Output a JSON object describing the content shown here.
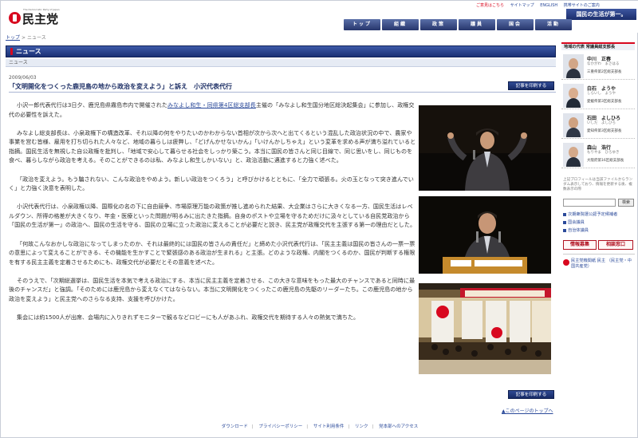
{
  "header": {
    "logo_tag": "The Democratic Party of Japan",
    "logo_name": "民主党",
    "utility": [
      "ご意見はこちら",
      "サイトマップ",
      "ENGLISH",
      "携帯サイトのご案内"
    ],
    "slogan": "国民の生活が第一。",
    "global_nav": [
      "トップ",
      "組織",
      "政策",
      "議員",
      "国会",
      "活動"
    ]
  },
  "breadcrumb": [
    "トップ",
    "ニュース"
  ],
  "section": {
    "title": "ニュース",
    "subtitle": "ニュース"
  },
  "article": {
    "date": "2009/06/03",
    "title": "「文明開化をつくった鹿児島の地から政治を変えよう」と訴え　小沢代表代行",
    "print_label": "記事を印刷する",
    "paragraphs": [
      "小沢一郎代表代行は3日夕、鹿児島県霧島市内で開催された みなよし和生・同県第4区総支部長主催の「みなよし和生国分地区総決起集会」に参加し、政権交代の必要性を訴えた。",
      "みなよし総支部長は、小泉政権下の構造改革、それ以降の何をやりたいのかわからない首相が次から次へと出てくるという混乱した政治状況の中で、農家や事業を営む皆様、雇用を打ち切られた人々など、地域の暮らしは疲弊し、「どげんかせないかん」「いけんかしちゃえ」という変革を求める声が満ち溢れていると指摘。国民生活を無視した自公政権を批判し、「地域で安心して暮らせる社会をしっかり築こう。本当に国民の皆さんと同じ目線で、同じ思いをし、同じものを食べ、暮らしながら政治を考える。そのことができるのは私、みなよし和生しかいない」と、政治活動に邁進すると力強く述べた。",
      "「政治を変えよう。もう騙されない、こんな政治をやめよう。新しい政治をつくろう」と呼びかけるとともに、「全力で頑張る。火の玉となって突き進んでいく」と力強く決意を表明した。",
      "小沢代表代行は、小泉政権以降、国際化の名の下に自由競争、市場原理万能の政策が推し進められた結果、大企業はさらに大きくなる一方、国民生活はレベルダウン、所得の格差が大きくなり、年金・医療といった問題が明るみに出たきた指摘。自身のポストや立場を守るためだけに汲々としている自民党政治から「国民の生活が第一」の政治へ、国民の生活を守る、国民の立場に立った政治に変えることが必要だと説き、民主党が政権交代を主張する第一の理由だとした。",
      "「何故こんなおかしな政治になってしまったのか、それは最終的には国民の皆さんの責任だ」と締めた小沢代表代行は、「民主主義は国民の皆さんの一票一票の意思によって変えることができる、その機能を生かすことで緊張感のある政治が生まれる」と主張。どのような政権、内閣をつくるのか、国民が判断する権限を有する民主主義を定着させるためにも、政権交代が必要だとその意義を述べた。",
      "そのうえで、「次期総選挙は、国民生活を本気で考える政治にする、本当に民主主義を定着させる、この大きな意味をもった最大のチャンスであると同時に最後のチャンスだ」と強調。「そのためには鹿児島から変えなくてはならない。本当に文明開化をつくったこの鹿児島の先駆のリーダーたち。この鹿児島の地から政治を変えよう」と民主党へのさらなる支持、支援を呼びかけた。",
      "集会には約1500人が出席、会場内に入りきれずモニターで観るなどロビーにも人があふれ、政権交代を期待する人々の熱気で満ちた。"
    ],
    "link_text": "みなよし和生・同県第4区総支部長"
  },
  "back_to_top": "▲このページのトップへ",
  "sidebar": {
    "heading": "地域の代表 常議員総支部長",
    "members": [
      {
        "name": "中川　正春",
        "kana": "なかがわ　まさはる",
        "district": "三重県第2区総支部長"
      },
      {
        "name": "白石　ようや",
        "kana": "しらいし　ようや",
        "district": "愛媛県第3区総支部長"
      },
      {
        "name": "石田　よしひろ",
        "kana": "いしだ　よしひろ",
        "district": "愛知県第3区総支部長"
      },
      {
        "name": "森山　浩行",
        "kana": "もりやま　ひろゆき",
        "district": "大阪府第16区総支部長"
      }
    ],
    "note": "上記プロフィールは当該ファイルからランダム表示しており、情報を更新する後、複数表示の際",
    "search_placeholder": "",
    "search_button": "検索",
    "links": [
      "次期衆院選公認予定候補者",
      "国会議員",
      "自治体議員"
    ],
    "banner_left": "情報募集",
    "banner_right": "相談窓口",
    "publication": "民主党機関紙 民主 （民主党・中国共産党）"
  },
  "footer": {
    "links": [
      "ダウンロード",
      "プライバシーポリシー",
      "サイト利用条件",
      "リンク",
      "党本部へのアクセス"
    ]
  },
  "colors": {
    "brand_red": "#d8081f",
    "nav_blue": "#26366c",
    "link_blue": "#2b4a9a"
  }
}
